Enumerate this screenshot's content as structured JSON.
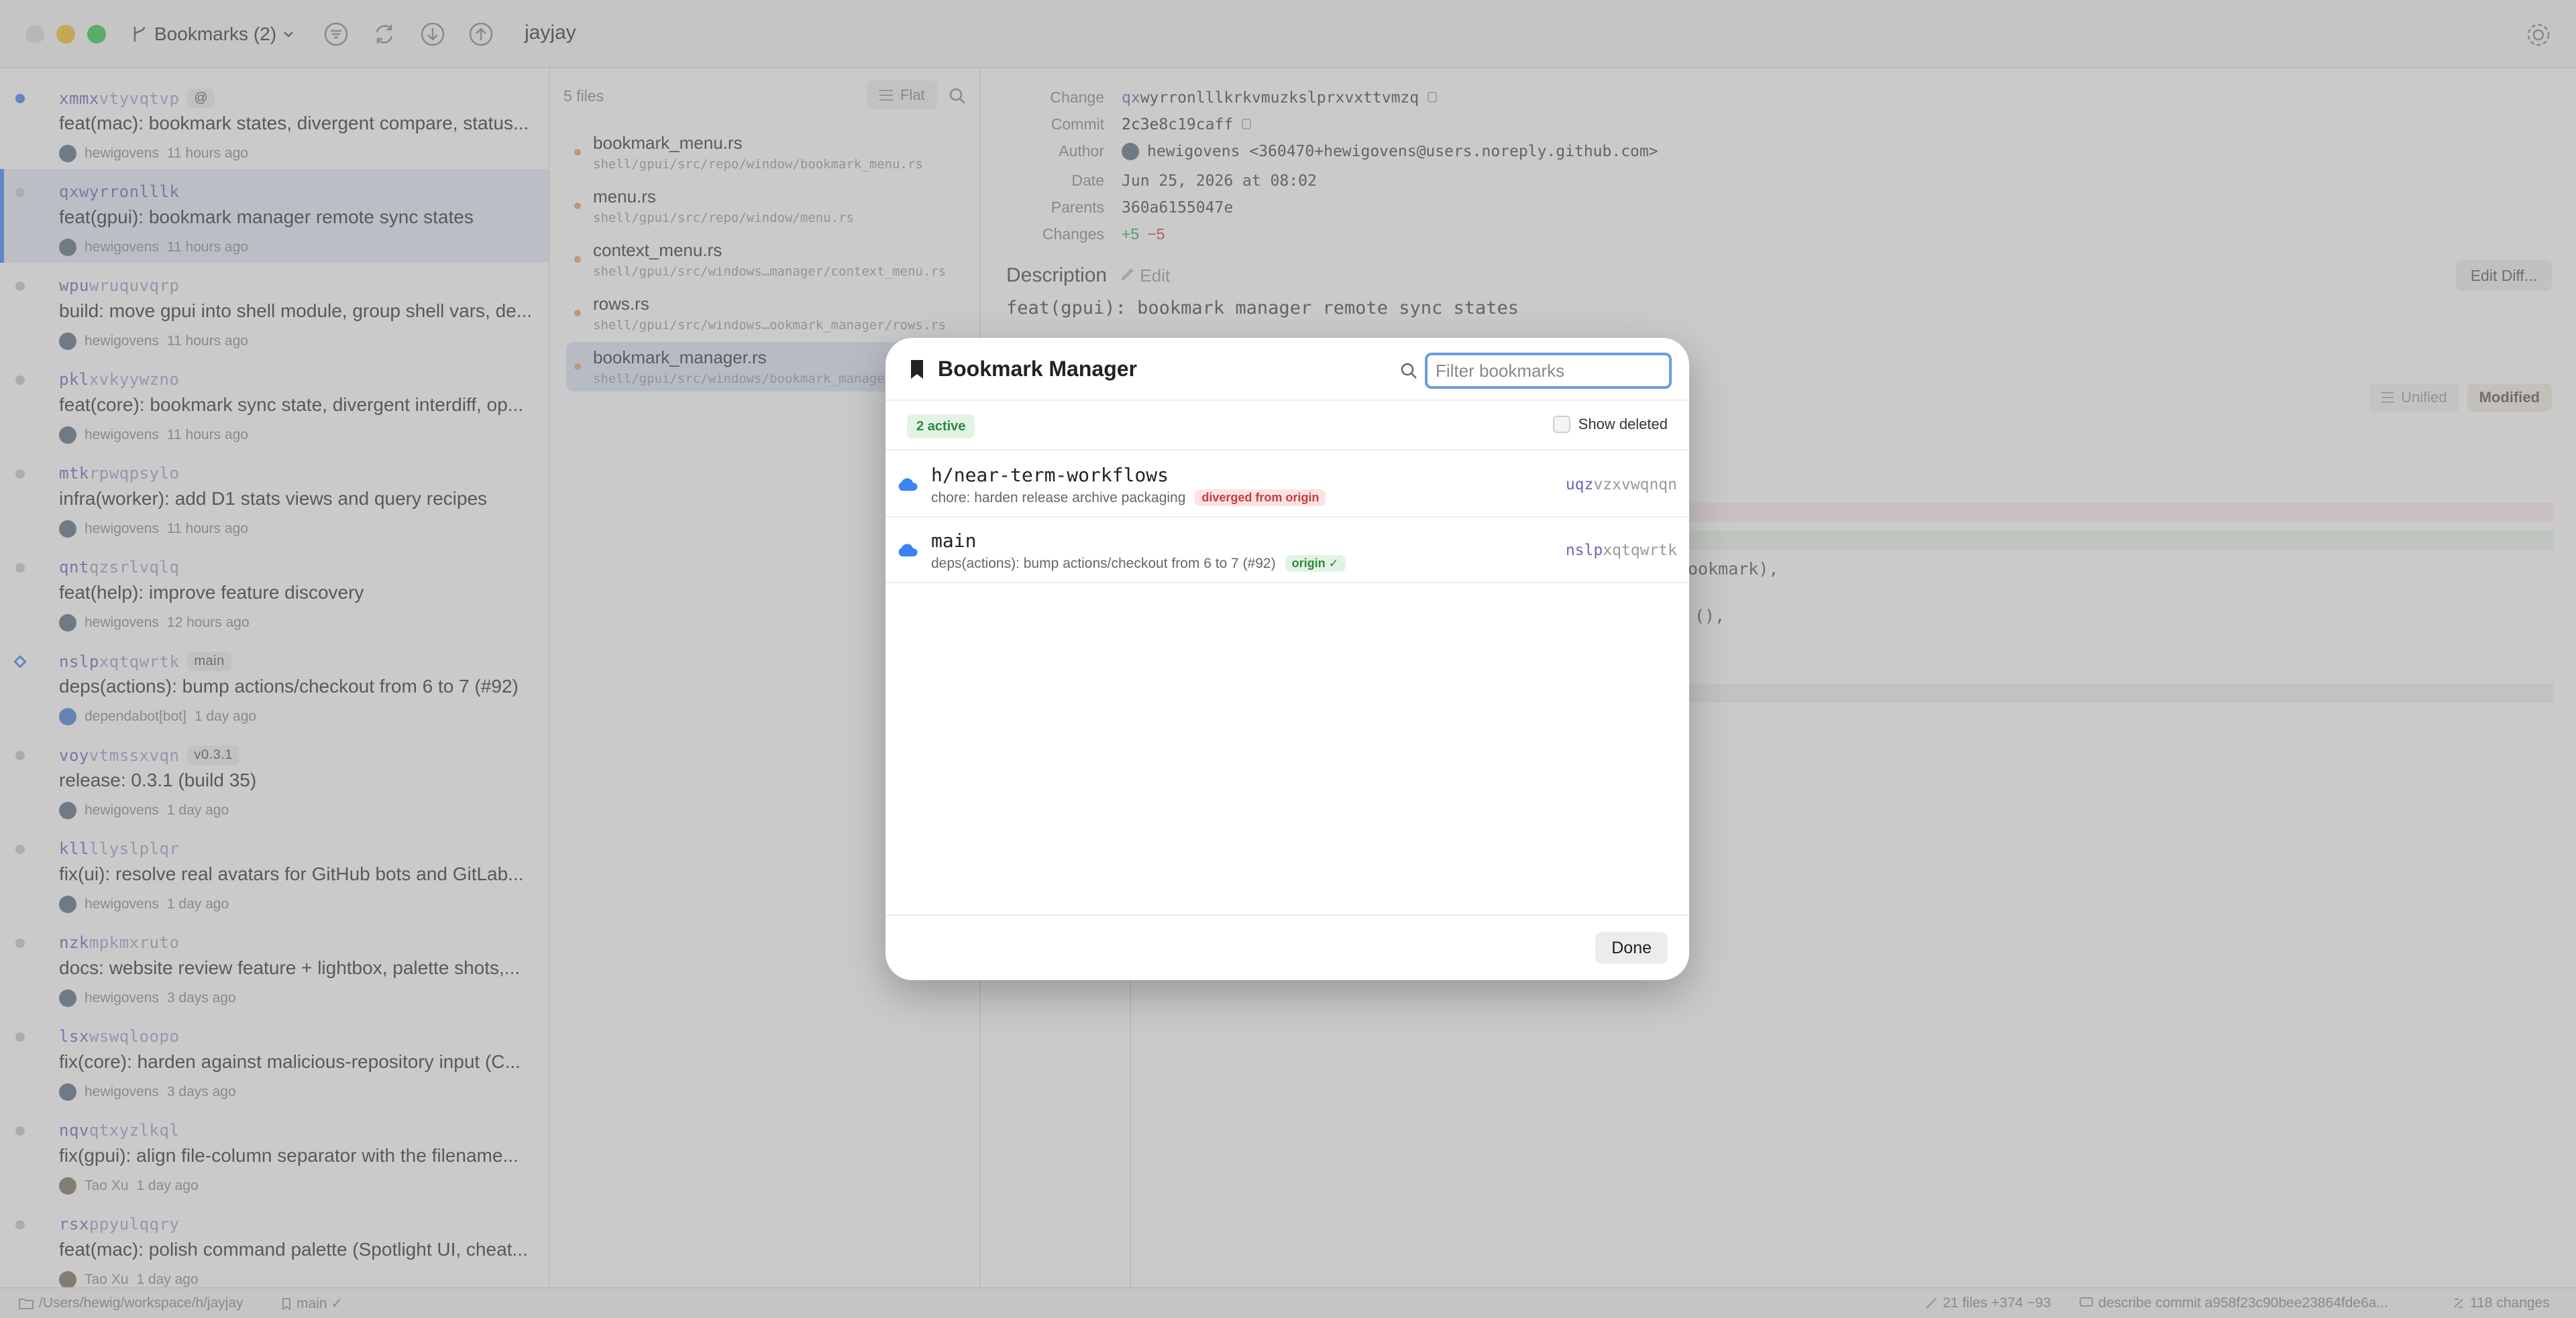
{
  "toolbar": {
    "branch_label": "Bookmarks (2)",
    "repo_name": "jayjay",
    "icons": [
      "filter-icon",
      "refresh-icon",
      "fetch-icon",
      "push-icon",
      "settings-icon"
    ]
  },
  "commits": [
    {
      "id_pre": "xmmx",
      "id_rest": "vtyvqtvp",
      "tag": "@",
      "msg": "feat(mac): bookmark states, divergent compare, status...",
      "author": "hewigovens",
      "time": "11 hours ago"
    },
    {
      "id_pre": "qxwyrronlllk",
      "id_rest": "",
      "tag": "",
      "msg": "feat(gpui): bookmark manager remote sync states",
      "author": "hewigovens",
      "time": "11 hours ago"
    },
    {
      "id_pre": "wpu",
      "id_rest": "wruquvqrp",
      "tag": "",
      "msg": "build: move gpui into shell module, group shell vars, de...",
      "author": "hewigovens",
      "time": "11 hours ago"
    },
    {
      "id_pre": "pkl",
      "id_rest": "xvkyywzno",
      "tag": "",
      "msg": "feat(core): bookmark sync state, divergent interdiff, op...",
      "author": "hewigovens",
      "time": "11 hours ago"
    },
    {
      "id_pre": "mtk",
      "id_rest": "rpwqpsylo",
      "tag": "",
      "msg": "infra(worker): add D1 stats views and query recipes",
      "author": "hewigovens",
      "time": "11 hours ago"
    },
    {
      "id_pre": "qnt",
      "id_rest": "qzsrlvqlq",
      "tag": "",
      "msg": "feat(help): improve feature discovery",
      "author": "hewigovens",
      "time": "12 hours ago"
    },
    {
      "id_pre": "nslp",
      "id_rest": "xqtqwrtk",
      "tag": "main",
      "msg": "deps(actions): bump actions/checkout from 6 to 7 (#92)",
      "author": "dependabot[bot]",
      "time": "1 day ago"
    },
    {
      "id_pre": "voy",
      "id_rest": "vtmssxvqn",
      "tag": "v0.3.1",
      "msg": "release: 0.3.1 (build 35)",
      "author": "hewigovens",
      "time": "1 day ago"
    },
    {
      "id_pre": "kll",
      "id_rest": "llyslplqr",
      "tag": "",
      "msg": "fix(ui): resolve real avatars for GitHub bots and GitLab...",
      "author": "hewigovens",
      "time": "1 day ago"
    },
    {
      "id_pre": "nzk",
      "id_rest": "mpkmxruto",
      "tag": "",
      "msg": "docs: website review feature + lightbox, palette shots,...",
      "author": "hewigovens",
      "time": "3 days ago"
    },
    {
      "id_pre": "lsx",
      "id_rest": "wswqloopo",
      "tag": "",
      "msg": "fix(core): harden against malicious-repository input (C...",
      "author": "hewigovens",
      "time": "3 days ago"
    },
    {
      "id_pre": "nqv",
      "id_rest": "qtxyzlkql",
      "tag": "",
      "msg": "fix(gpui): align file-column separator with the filename...",
      "author": "Tao Xu",
      "time": "1 day ago"
    },
    {
      "id_pre": "rsx",
      "id_rest": "ppyulqqry",
      "tag": "",
      "msg": "feat(mac): polish command palette (Spotlight UI, cheat...",
      "author": "Tao Xu",
      "time": "1 day ago"
    }
  ],
  "files": {
    "count": "5 files",
    "flat_label": "Flat",
    "items": [
      {
        "name": "bookmark_menu.rs",
        "path": "shell/gpui/src/repo/window/bookmark_menu.rs"
      },
      {
        "name": "menu.rs",
        "path": "shell/gpui/src/repo/window/menu.rs"
      },
      {
        "name": "context_menu.rs",
        "path": "shell/gpui/src/windows…manager/context_menu.rs"
      },
      {
        "name": "rows.rs",
        "path": "shell/gpui/src/windows…ookmark_manager/rows.rs"
      },
      {
        "name": "bookmark_manager.rs",
        "path": "shell/gpui/src/windows/bookmark_manager"
      }
    ]
  },
  "detail": {
    "change_key": "Change",
    "change_val_pre": "qx",
    "change_val_rest": "wyrronlllkrkvmuzkslprxvxttvmzq",
    "commit_key": "Commit",
    "commit_val_pre": "2c3e",
    "commit_val_rest": "8c19caff",
    "author_key": "Author",
    "author_val": "hewigovens <360470+hewigovens@users.noreply.github.com>",
    "date_key": "Date",
    "date_val": "Jun 25, 2026 at 08:02",
    "parents_key": "Parents",
    "parents_val": "360a6155047e",
    "changes_key": "Changes",
    "changes_plus": "+5",
    "changes_minus": "−5",
    "desc_title": "Description",
    "desc_edit": "Edit",
    "edit_diff_label": "Edit Diff...",
    "desc_text": "feat(gpui): bookmark manager remote sync states",
    "unified_label": "Unified",
    "modified_label": "Modified",
    "diff_frag_1": "ookmark),",
    "diff_frag_2": "(),"
  },
  "status": {
    "path": "/Users/hewig/workspace/h/jayjay",
    "branch": "main ✓",
    "files_summary": "21 files +374 −93",
    "describe": "describe commit a958f23c90bee23864fde6a...",
    "changes": "118 changes"
  },
  "modal": {
    "title": "Bookmark Manager",
    "filter_placeholder": "Filter bookmarks",
    "active_badge": "2 active",
    "show_deleted": "Show deleted",
    "bookmarks": [
      {
        "name": "h/near-term-workflows",
        "desc": "chore: harden release archive packaging",
        "pill": "diverged from origin",
        "pill_type": "red",
        "id_pre": "uqz",
        "id_rest": "vzxvwqnqn"
      },
      {
        "name": "main",
        "desc": "deps(actions): bump actions/checkout from 6 to 7 (#92)",
        "pill": "origin ✓",
        "pill_type": "green",
        "id_pre": "nslp",
        "id_rest": "xqtqwrtk"
      }
    ],
    "done_label": "Done"
  },
  "colors": {
    "accent": "#3b82f6",
    "change_id": "#6a66bd",
    "diverged": "#c93c3c",
    "synced": "#2a8a3e"
  }
}
